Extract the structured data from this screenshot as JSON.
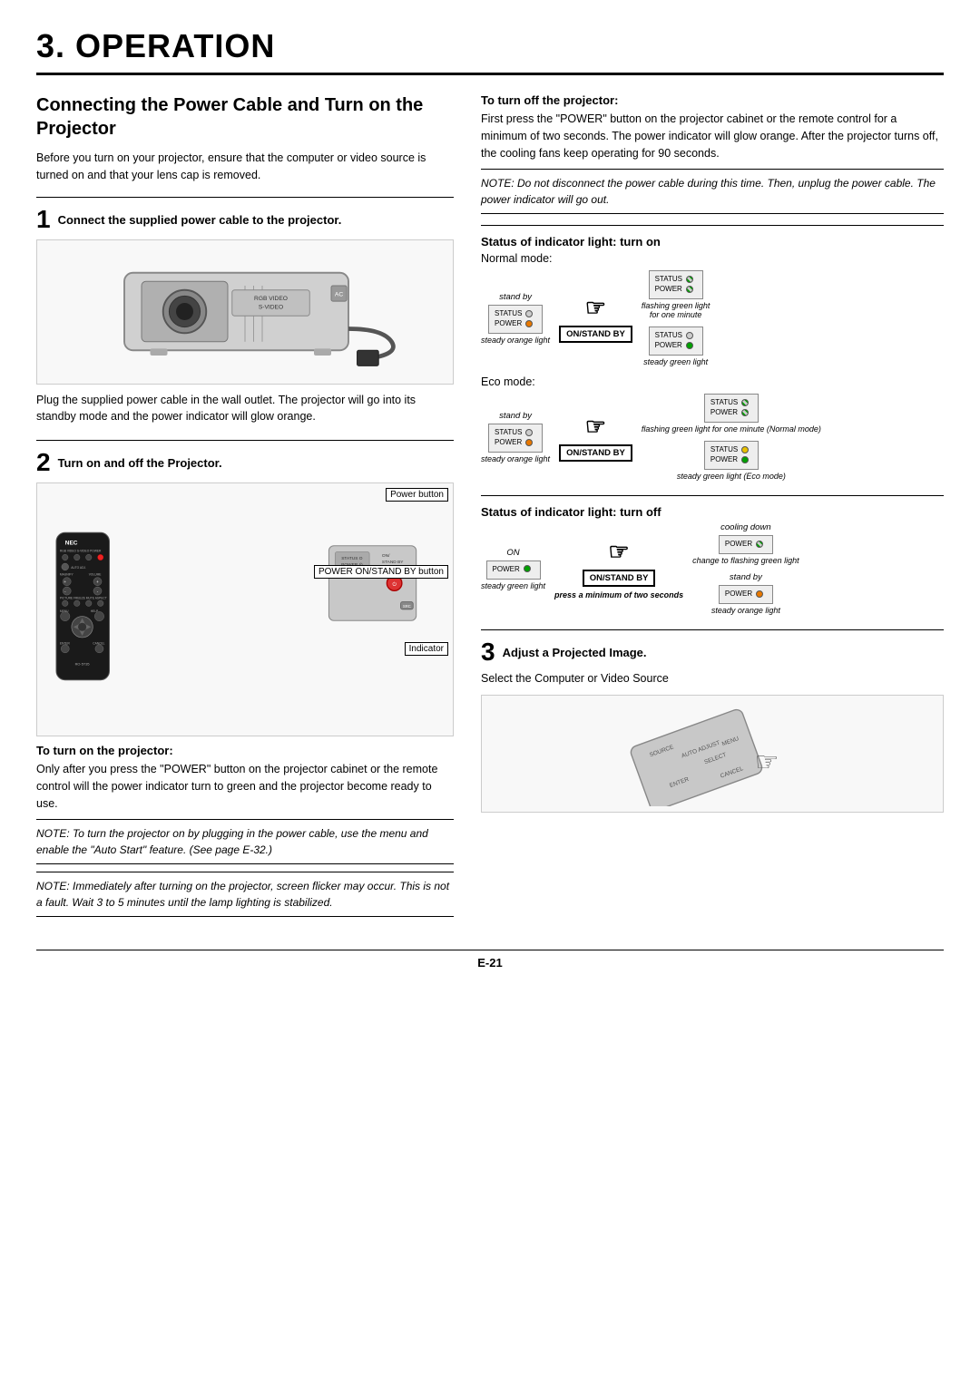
{
  "page": {
    "chapter": "3. OPERATION",
    "footer": "E-21"
  },
  "section1": {
    "title": "Connecting the Power Cable and Turn on the Projector",
    "intro": "Before you turn on your projector, ensure that the computer or video source is turned on and that your lens cap is removed.",
    "step1_label": "Connect the supplied power cable to the projector.",
    "step1_subtext": "Plug the supplied power cable in the wall outlet. The projector will go into its standby mode and the power indicator will glow orange.",
    "step2_label": "Turn on and off the Projector.",
    "power_button_label": "Power button",
    "power_on_stand_by_label": "POWER ON/STAND BY button",
    "indicator_label": "Indicator",
    "turn_on_title": "To turn on the projector:",
    "turn_on_text": "Only after you press the \"POWER\" button on the projector cabinet or the remote control will the power indicator turn to green and the projector become ready to use.",
    "note1": "NOTE: To turn the projector on by plugging in the power cable, use the menu and enable the \"Auto Start\" feature. (See page E-32.)",
    "note2": "NOTE: Immediately after turning on the projector, screen flicker may occur. This is not a fault. Wait 3 to 5 minutes until the lamp lighting is stabilized."
  },
  "section2": {
    "turn_off_title": "To turn off the projector:",
    "turn_off_text": "First press the \"POWER\" button on the projector cabinet or the remote control for a minimum of two seconds. The power indicator will glow orange. After the projector turns off, the cooling fans keep operating for 90 seconds.",
    "note3": "NOTE: Do not disconnect the power cable during this time. Then, unplug the power cable. The power indicator will go out.",
    "status_on_title": "Status of indicator light: turn on",
    "normal_mode_label": "Normal mode:",
    "stand_by_label": "stand by",
    "on_stand_by_btn": "ON/STAND BY",
    "steady_orange_light": "steady orange light",
    "flashing_green_label": "flashing green light",
    "for_one_minute": "for one minute",
    "steady_green_label": "steady green light",
    "eco_mode_label": "Eco mode:",
    "flashing_green_normal": "flashing green light for one minute (Normal mode)",
    "steady_green_eco": "steady green light (Eco mode)",
    "status_off_title": "Status of indicator light: turn off",
    "on_label": "ON",
    "steady_green_on": "steady green light",
    "press_min": "press a minimum of two seconds",
    "cooling_down": "cooling down",
    "change_flashing": "change to flashing green light",
    "stand_by2": "stand by",
    "steady_orange2": "steady orange light"
  },
  "section3": {
    "step3_label": "Adjust a Projected Image.",
    "step3_subtext": "Select the Computer or Video Source"
  },
  "labels": {
    "status": "STATUS",
    "power": "POWER",
    "nec": "NEC"
  }
}
